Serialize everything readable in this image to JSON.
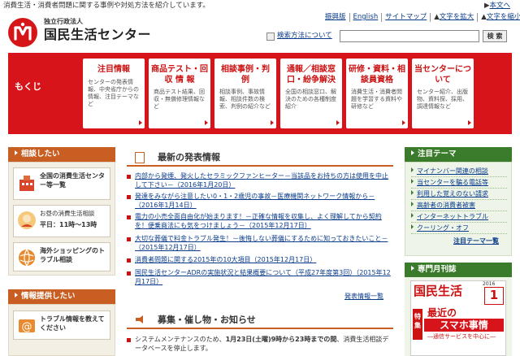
{
  "header": {
    "tagline": "消費生活・消費者問題に関する事例や対処方法を紹介しています。",
    "skip_link": "本文へ",
    "org_sub": "独立行政法人",
    "org_name": "国民生活センター",
    "top_links": [
      "振興版",
      "English",
      "サイトマップ",
      "文字を拡大",
      "文字を縮小"
    ],
    "search_help": "検索方法について",
    "search_value": "",
    "search_button": "検 索"
  },
  "nav": {
    "label": "もくじ",
    "items": [
      {
        "title": "注目情報",
        "desc": "センターの発表情報、中央省庁からの情報、注目テーマなど"
      },
      {
        "title": "商品テスト・回 収 情 報",
        "desc": "商品テスト結果、回収・無償修理情報など"
      },
      {
        "title": "相談事例・判　　例",
        "desc": "相談事例、事故情報、相談件数の検索、判例の紹介など"
      },
      {
        "title": "通報／相談窓口・紛争解決",
        "desc": "全国の相談窓口、解決のための各種制度紹介"
      },
      {
        "title": "研修・資料・相談員資格",
        "desc": "消費生活・消費者問題を学習する資料や研修など"
      },
      {
        "title": "当センターについて",
        "desc": "センター紹介、出版物、資料探、採用、調達情報など"
      }
    ]
  },
  "left": {
    "consult_head": "相談したい",
    "cards": [
      {
        "text": "全国の消費生活センター等一覧"
      },
      {
        "text": "お昼の消費生活相談",
        "sub": "平日：11時～13時"
      },
      {
        "text": "海外ショッピングのトラブル相談"
      }
    ],
    "provide_head": "情報提供したい",
    "provide_card": "トラブル情報を教えてください"
  },
  "news": {
    "title": "最新の発表情報",
    "items": [
      "内部から発煙、発火したセラミックファンヒーター－当該品をお持ちの方は使用を中止して下さい－（2016年1月20日）",
      "発達をみながら注意したい0・1・2歳児の事故－医療機関ネットワーク情報から－（2016年1月14日）",
      "電力の小売全面自由化が始まります！－正確な情報を収集し、よく理解してから契約を！便乗商法にも気をつけましょう－（2015年12月17日）",
      "大切な葬儀で料金トラブル発生！－後悔しない葬儀にするために知っておきたいこと－（2015年12月17日）",
      "消費者問題に関する2015年の10大項目（2015年12月17日）",
      "国民生活センターADRの実施状況と結果概要について（平成27年度第3回）（2015年12月17日）"
    ],
    "more": "発表情報一覧"
  },
  "events": {
    "title": "募集・催し物・お知らせ",
    "item_pre": "システムメンテナンスのため、",
    "item_bold": "1月23日(土曜)9時から23時までの間",
    "item_post": "、消費生活相談データベースを停止します。"
  },
  "right": {
    "focus_head": "注目テーマ",
    "focus_items": [
      "マイナンバー関連の相談",
      "当センターを騙る電話等",
      "利用した覚えのない請求",
      "高齢者の消費者被害",
      "インターネットトラブル",
      "クーリング・オフ"
    ],
    "focus_more": "注目テーマ一覧",
    "mag_head": "専門月刊誌",
    "mag_title": "国民生活",
    "mag_year": "2016",
    "mag_num": "1",
    "mag_tokushu": "特集",
    "mag_head1": "最近の",
    "mag_head2": "スマホ事情",
    "mag_head3": "―通信サービスを中心に―"
  }
}
